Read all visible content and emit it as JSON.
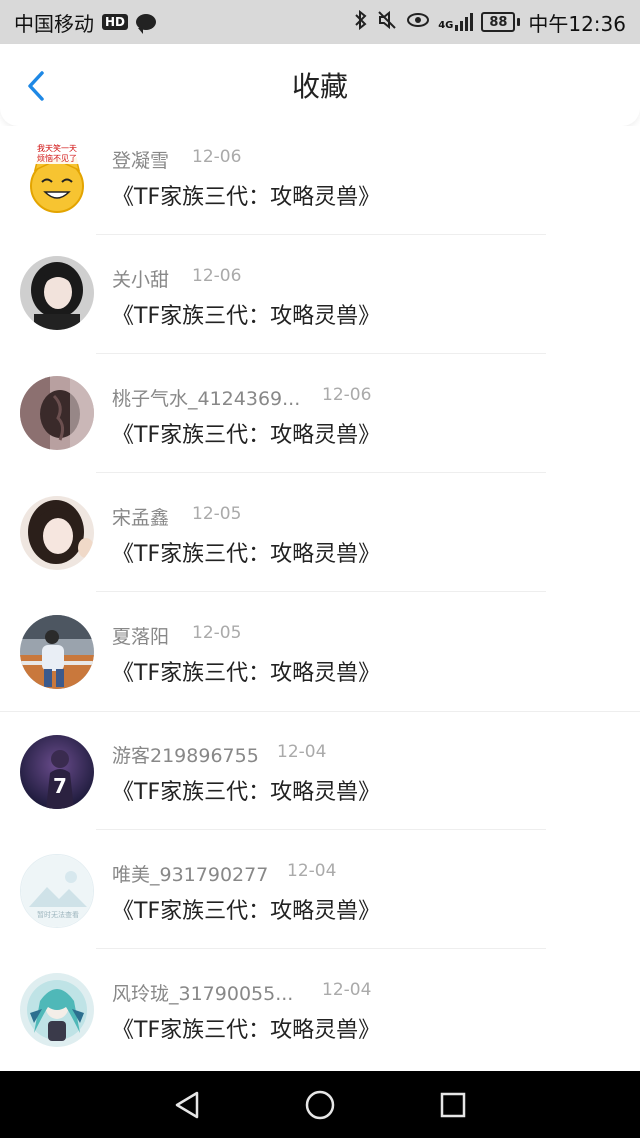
{
  "statusbar": {
    "carrier": "中国移动",
    "hd": "HD",
    "network": "4G",
    "battery": "88",
    "time": "中午12:36",
    "icons": [
      "bluetooth-icon",
      "mute-icon",
      "eye-icon",
      "signal-icon",
      "battery-icon"
    ]
  },
  "header": {
    "title": "收藏",
    "back_icon": "chevron-left-icon"
  },
  "items": [
    {
      "name": "登凝雪",
      "date": "12-06",
      "title": "《TF家族三代：攻略灵兽》"
    },
    {
      "name": "关小甜",
      "date": "12-06",
      "title": "《TF家族三代：攻略灵兽》"
    },
    {
      "name": "桃子气水_4124369...",
      "date": "12-06",
      "title": "《TF家族三代：攻略灵兽》"
    },
    {
      "name": "宋孟鑫",
      "date": "12-05",
      "title": "《TF家族三代：攻略灵兽》"
    },
    {
      "name": "夏落阳",
      "date": "12-05",
      "title": "《TF家族三代：攻略灵兽》"
    },
    {
      "name": "游客219896755",
      "date": "12-04",
      "title": "《TF家族三代：攻略灵兽》"
    },
    {
      "name": "唯美_931790277",
      "date": "12-04",
      "title": "《TF家族三代：攻略灵兽》"
    },
    {
      "name": "风玲珑_31790055...",
      "date": "12-04",
      "title": "《TF家族三代：攻略灵兽》"
    }
  ],
  "avatar_texts": {
    "cat_sticker": "我天笑一天\n烦恼不见了",
    "jersey_number": "7",
    "placeholder": "暂时无法查看"
  },
  "navbar": {
    "icons": [
      "back-triangle-icon",
      "home-circle-icon",
      "recents-square-icon"
    ]
  },
  "colors": {
    "accent": "#1e88e5",
    "statusbar_bg": "#d9d9d9",
    "navbar_bg": "#000000"
  }
}
